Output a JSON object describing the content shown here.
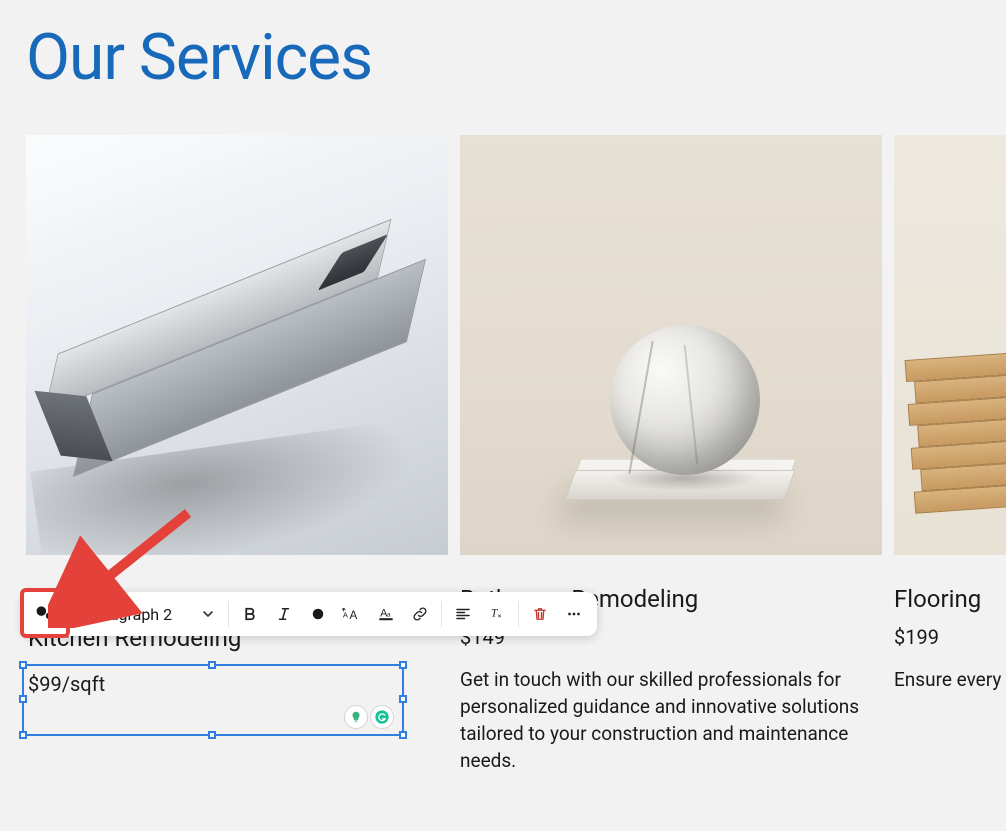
{
  "page": {
    "title": "Our Services"
  },
  "toolbar": {
    "text_style": "Paragraph 2"
  },
  "services": [
    {
      "title": "Kitchen Remodeling",
      "price": "$99/sqft",
      "description": ""
    },
    {
      "title": "Bathroom Remodeling",
      "price": "$149",
      "description": "Get in touch with our skilled professionals for personalized guidance and innovative solutions tailored to your construction and maintenance needs."
    },
    {
      "title": "Flooring",
      "price": "$199",
      "description": "Ensure every project meets top safety standards with thorough inspections. Our expert team audits processes and protocols, guaranteeing robust, compliant builds and worksites."
    }
  ]
}
